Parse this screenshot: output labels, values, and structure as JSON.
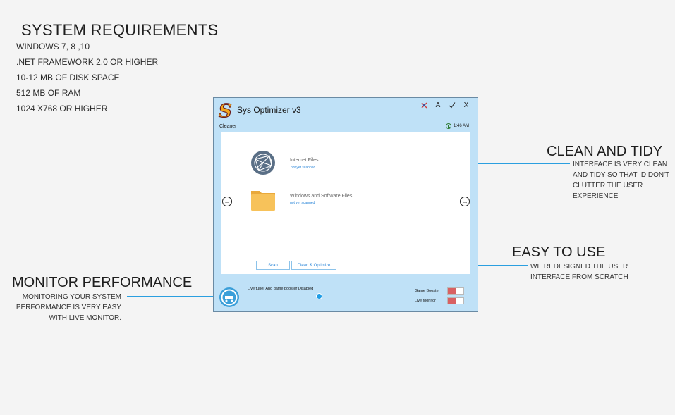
{
  "requirements": {
    "title": "SYSTEM REQUIREMENTS",
    "items": [
      "WINDOWS 7, 8 ,10",
      ".NET FRAMEWORK 2.0 OR HIGHER",
      "10-12 MB OF DISK SPACE",
      "512 MB OF RAM",
      "1024 X768 OR HIGHER"
    ]
  },
  "callouts": {
    "clean": {
      "title": "CLEAN AND TIDY",
      "lines": [
        "INTERFACE IS VERY CLEAN",
        "AND TIDY SO THAT ID DON'T",
        "CLUTTER THE USER",
        "EXPERIENCE"
      ]
    },
    "easy": {
      "title": "EASY TO USE",
      "lines": [
        "WE REDESIGNED THE USER",
        "INTERFACE FROM SCRATCH"
      ]
    },
    "monitor": {
      "title": "MONITOR PERFORMANCE",
      "lines": [
        "MONITORING YOUR SYSTEM",
        "PERFORMANCE IS VERY EASY",
        "WITH LIVE MONITOR."
      ]
    }
  },
  "app": {
    "title": "Sys Optimizer v3",
    "logo_letter": "S",
    "controls": {
      "pin": "pin-icon",
      "font": "A",
      "minimize": "check-icon",
      "close": "X"
    },
    "section": "Cleaner",
    "time": "1:46 AM",
    "items": [
      {
        "name": "Internet Files",
        "status": "not yet scanned",
        "icon": "globe-network-icon"
      },
      {
        "name": "Windows and Software Files",
        "status": "not yet scanned",
        "icon": "folder-icon"
      }
    ],
    "buttons": {
      "scan": "Scan",
      "clean": "Clean & Optimize"
    },
    "status": "Live tuner And game booster Disabled",
    "toggles": [
      {
        "label": "Game Booster",
        "state": "off"
      },
      {
        "label": "Live Monitor",
        "state": "off"
      }
    ],
    "colors": {
      "window_bg": "#bfe1f7",
      "accent": "#2b86d8",
      "toggle_off": "#d86163"
    }
  }
}
